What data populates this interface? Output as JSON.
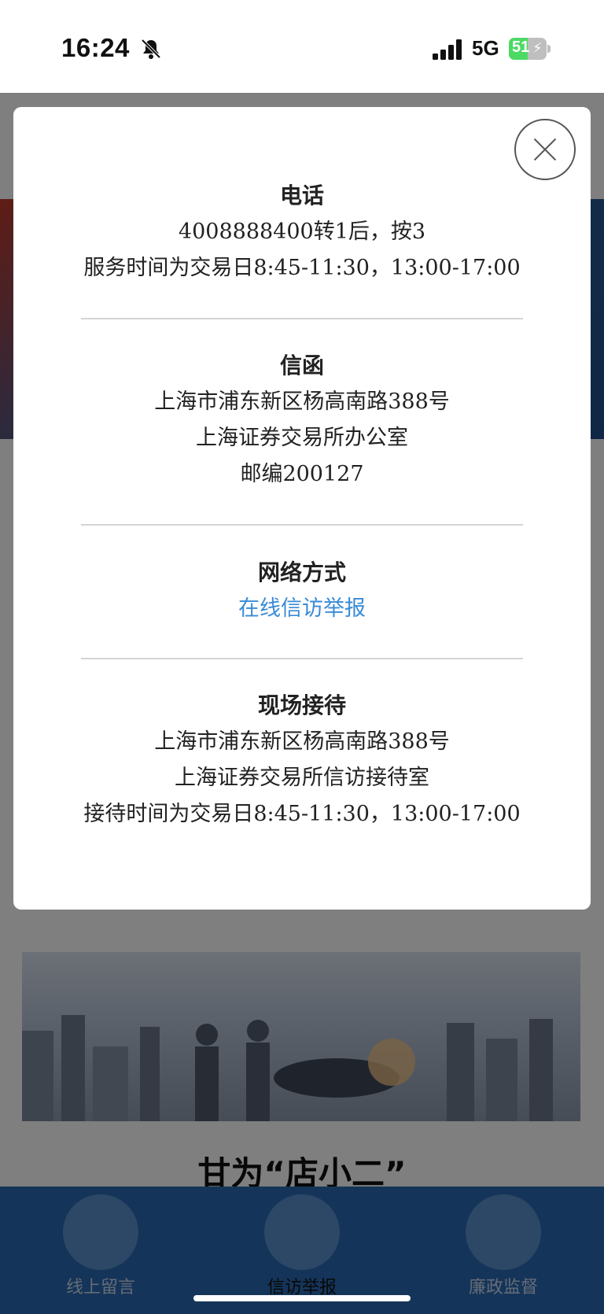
{
  "status_bar": {
    "time": "16:24",
    "network": "5G",
    "battery": "51",
    "battery_fraction": 0.51
  },
  "modal": {
    "sections": [
      {
        "title": "电话",
        "lines": [
          "4008888400转1后，按3",
          "服务时间为交易日8:45-11:30，13:00-17:00"
        ]
      },
      {
        "title": "信函",
        "lines": [
          "上海市浦东新区杨高南路388号",
          "上海证券交易所办公室",
          "邮编200127"
        ]
      },
      {
        "title": "网络方式",
        "link": "在线信访举报"
      },
      {
        "title": "现场接待",
        "lines": [
          "上海市浦东新区杨高南路388号",
          "上海证券交易所信访接待室",
          "接待时间为交易日8:45-11:30，13:00-17:00"
        ]
      }
    ]
  },
  "page": {
    "heading": "甘为“店小二”"
  },
  "tabbar": {
    "items": [
      {
        "label": "线上留言",
        "icon": "chat-person-icon"
      },
      {
        "label": "信访举报",
        "icon": "phone-hand-icon"
      },
      {
        "label": "廉政监督",
        "icon": "scale-document-icon"
      }
    ]
  },
  "colors": {
    "link": "#3a8bd6",
    "tabbar": "#2a69b2",
    "overlay": "rgba(0,0,0,0.5)"
  }
}
